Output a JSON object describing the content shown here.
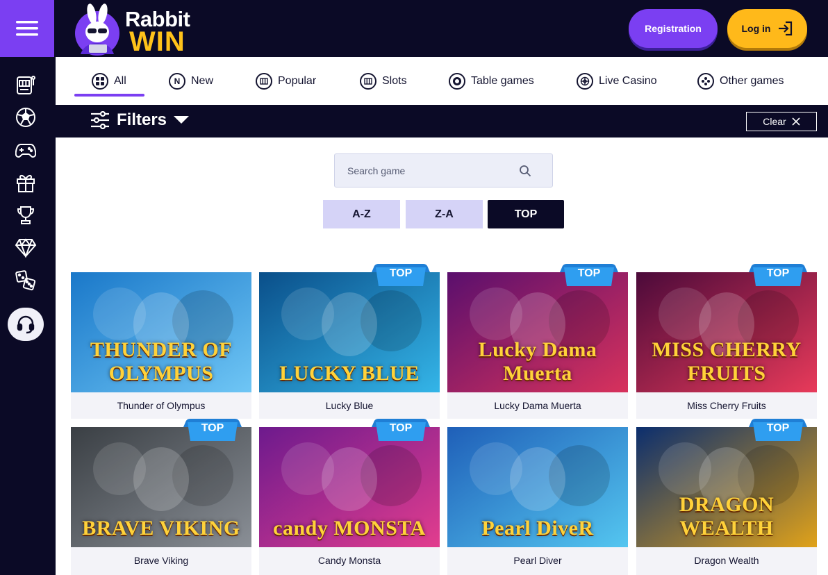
{
  "brand": {
    "line1": "Rabbit",
    "line2": "WIN"
  },
  "header": {
    "registration_label": "Registration",
    "login_label": "Log in"
  },
  "sidebar": {
    "icons": [
      "slot-machine-icon",
      "football-icon",
      "gamepad-icon",
      "gift-icon",
      "trophy-icon",
      "diamond-icon",
      "dice-icon"
    ],
    "support_icon": "headset-icon"
  },
  "tabs": [
    {
      "label": "All",
      "icon": "grid-icon",
      "active": true
    },
    {
      "label": "New",
      "icon": "new-icon"
    },
    {
      "label": "Popular",
      "icon": "popular-icon"
    },
    {
      "label": "Slots",
      "icon": "slots-icon"
    },
    {
      "label": "Table games",
      "icon": "table-games-icon"
    },
    {
      "label": "Live Casino",
      "icon": "live-casino-icon"
    },
    {
      "label": "Other games",
      "icon": "other-games-icon"
    }
  ],
  "filters": {
    "label": "Filters",
    "clear_label": "Clear"
  },
  "search": {
    "placeholder": "Search game"
  },
  "sort": {
    "az": "A-Z",
    "za": "Z-A",
    "top": "TOP",
    "active": "TOP"
  },
  "badge_label": "TOP",
  "games": [
    {
      "name": "Thunder of Olympus",
      "art_title": "THUNDER OF OLYMPUS",
      "top": false,
      "colors": [
        "#1a78c9",
        "#6fc6f5"
      ]
    },
    {
      "name": "Lucky Blue",
      "art_title": "LUCKY BLUE",
      "top": true,
      "colors": [
        "#0a4f8a",
        "#34b5e8"
      ]
    },
    {
      "name": "Lucky Dama Muerta",
      "art_title": "Lucky Dama Muerta",
      "top": true,
      "colors": [
        "#5a0f6d",
        "#d8325c"
      ]
    },
    {
      "name": "Miss Cherry Fruits",
      "art_title": "MISS CHERRY FRUITS",
      "top": true,
      "colors": [
        "#4b0a3a",
        "#e83a5a"
      ]
    },
    {
      "name": "Brave Viking",
      "art_title": "BRAVE VIKING",
      "top": true,
      "colors": [
        "#3a3f44",
        "#8a8f96"
      ]
    },
    {
      "name": "Candy Monsta",
      "art_title": "candy MONSTA",
      "top": true,
      "colors": [
        "#6d1a8d",
        "#e23d8e"
      ]
    },
    {
      "name": "Pearl Diver",
      "art_title": "Pearl DiveR",
      "top": false,
      "colors": [
        "#1f5fb8",
        "#54c6f0"
      ]
    },
    {
      "name": "Dragon Wealth",
      "art_title": "DRAGON WEALTH",
      "top": true,
      "colors": [
        "#0b2e6e",
        "#e0a21a"
      ]
    }
  ]
}
